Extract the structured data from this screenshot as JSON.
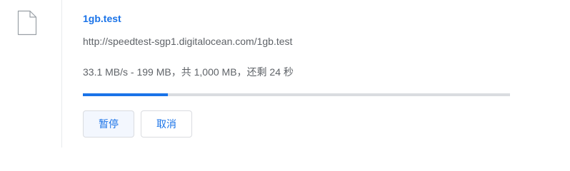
{
  "download": {
    "filename": "1gb.test",
    "url": "http://speedtest-sgp1.digitalocean.com/1gb.test",
    "status": "33.1 MB/s - 199 MB，共 1,000 MB，还剩 24 秒",
    "progress_fraction": 0.199,
    "file_icon": "file-icon"
  },
  "actions": {
    "pause_label": "暂停",
    "cancel_label": "取消"
  },
  "colors": {
    "accent": "#1a73e8",
    "track": "#dadce0",
    "pause_bg": "#f3f7fe"
  }
}
